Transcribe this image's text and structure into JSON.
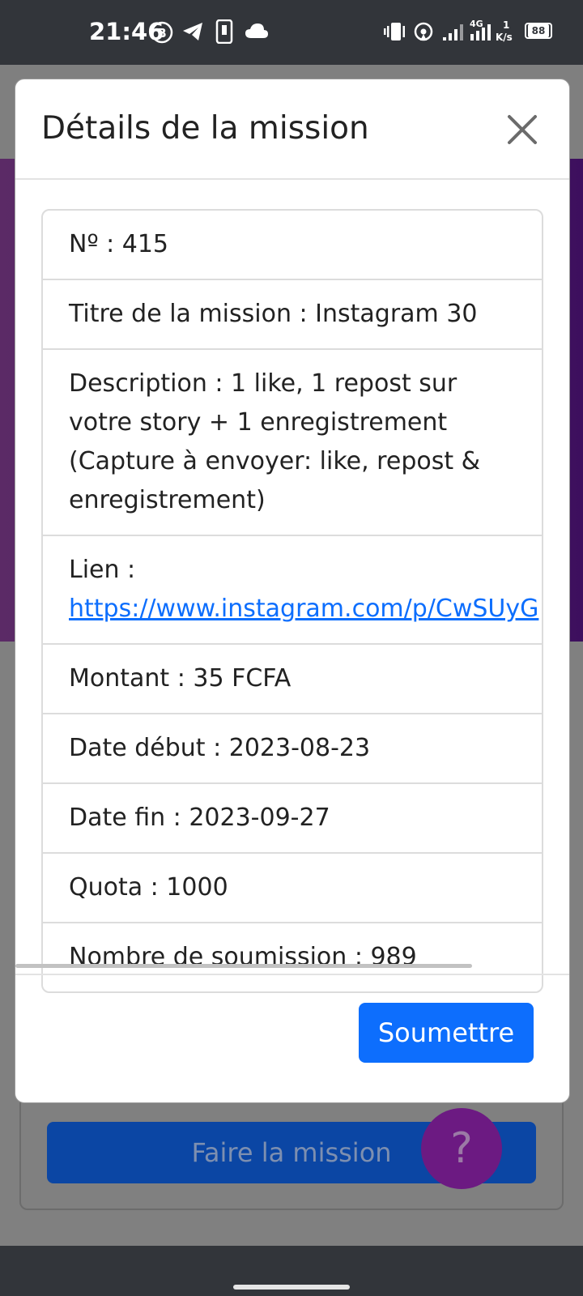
{
  "status_bar": {
    "time": "21:46",
    "network_label": "4G",
    "speed_value": "1",
    "speed_unit": "K/s",
    "battery": "88"
  },
  "background": {
    "action_button_label": "Faire la mission",
    "help_button_label": "?"
  },
  "modal": {
    "title": "Détails de la mission",
    "rows": [
      {
        "text": "Nº : 415"
      },
      {
        "text": "Titre de la mission : Instagram 30"
      },
      {
        "text": "Description : 1 like, 1 repost sur votre story + 1 enregistrement (Capture à envoyer: like, repost & enregistrement)"
      },
      {
        "label": "Lien :",
        "link": "https://www.instagram.com/p/CwSUyG"
      },
      {
        "text": "Montant : 35 FCFA"
      },
      {
        "text": "Date début : 2023-08-23"
      },
      {
        "text": "Date fin : 2023-09-27"
      },
      {
        "text": "Quota : 1000"
      },
      {
        "text": "Nombre de soumission : 989"
      }
    ],
    "submit_label": "Soumettre"
  },
  "colors": {
    "primary": "#0d6efd",
    "purple": "#4f1f66",
    "status_bar": "#32353a"
  }
}
